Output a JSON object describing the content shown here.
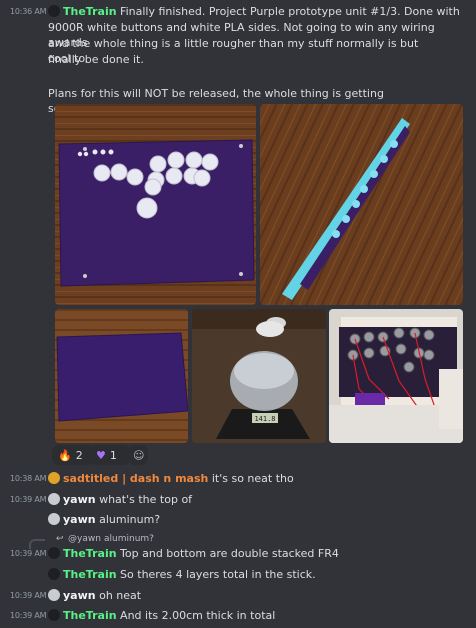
{
  "messages": [
    {
      "time": "10:36 AM",
      "author": "TheTrain",
      "text_line1": "Finally finished.  Project Purple prototype unit #1/3.  Done with",
      "text_line2": "9000R white buttons and white PLA sides.  Not going to win any wiring awards",
      "text_line3": "and the whole thing is a little rougher than my stuff normally is but cool to",
      "text_line4": "finally be done it.",
      "text_line5": "Plans for this will NOT be released, the whole thing is getting scrapped."
    },
    {
      "time": "10:38 AM",
      "author": "sadtitled | dash n mash",
      "text": "it's so neat tho"
    },
    {
      "time": "10:39 AM",
      "author": "yawn",
      "text": "what's the top of"
    },
    {
      "time": "",
      "author": "yawn",
      "text": "aluminum?"
    },
    {
      "reply_to": "@yawn",
      "reply_text": "aluminum?"
    },
    {
      "time": "10:39 AM",
      "author": "TheTrain",
      "text": "Top and bottom are double stacked FR4"
    },
    {
      "time": "",
      "author": "TheTrain",
      "text": "So theres 4 layers total in the stick."
    },
    {
      "time": "10:39 AM",
      "author": "yawn",
      "text": "oh neat"
    },
    {
      "time": "10:39 AM",
      "author": "TheTrain",
      "text": "And its 2.00cm thick in total"
    }
  ],
  "reactions": [
    {
      "emoji": "fire",
      "count": "2"
    },
    {
      "emoji": "purple-heart",
      "count": "1"
    },
    {
      "emoji": "add-reaction-icon",
      "count": ""
    }
  ],
  "photos": [
    {
      "name": "photo-stick-top"
    },
    {
      "name": "photo-stick-side"
    },
    {
      "name": "photo-panel-plain"
    },
    {
      "name": "photo-scale"
    },
    {
      "name": "photo-wiring"
    }
  ],
  "colors": {
    "background": "#313338",
    "green_name": "#57f287",
    "orange_name": "#f0883e",
    "purple_panel": "#3b1f66"
  }
}
